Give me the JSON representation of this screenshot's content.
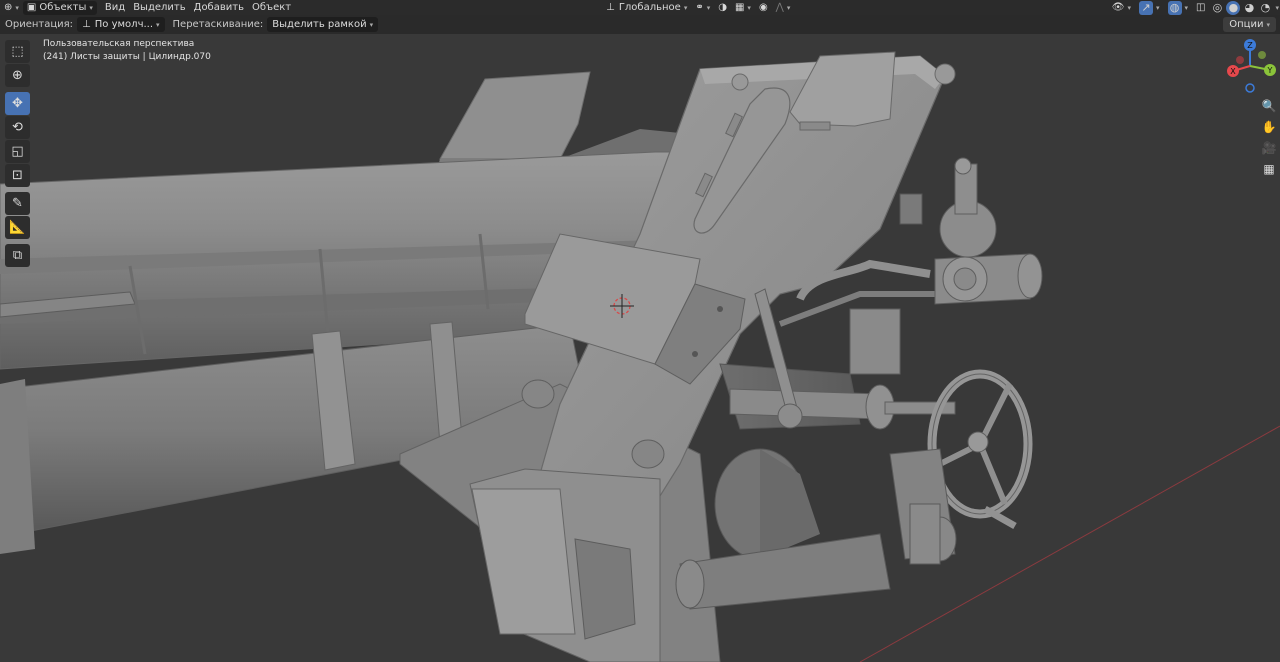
{
  "header": {
    "editor_icon": "3d-viewport-icon",
    "mode": "Объекты",
    "menus": [
      "Вид",
      "Выделить",
      "Добавить",
      "Объект"
    ],
    "transform_orientation": "Глобальное"
  },
  "tool_settings": {
    "orientation_label": "Ориентация:",
    "orientation_value": "По умолч...",
    "drag_label": "Перетаскивание:",
    "drag_value": "Выделить рамкой",
    "options": "Опции"
  },
  "viewport": {
    "view_name": "Пользовательская перспектива",
    "object_info": "(241) Листы защиты | Цилиндр.070"
  },
  "gizmo": {
    "x": "X",
    "y": "Y",
    "z": "Z",
    "colors": {
      "x": "#e6484c",
      "y": "#8bc43a",
      "z": "#3c7bd9"
    }
  },
  "colors": {
    "background": "#393939",
    "header": "#2b2b2b",
    "accent": "#4772b3",
    "model": "#8a8a8a"
  }
}
